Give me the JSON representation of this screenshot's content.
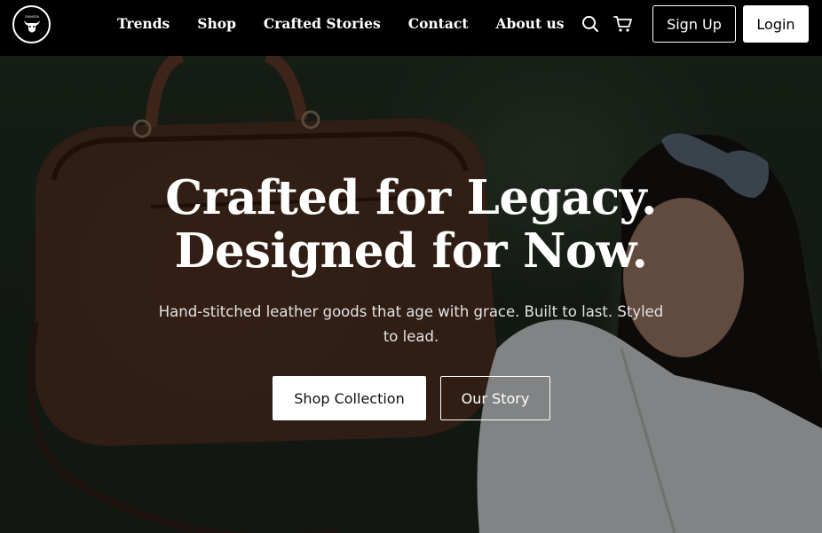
{
  "brand": {
    "logo_text": "ZAMAEDA"
  },
  "nav": {
    "items": [
      {
        "label": "Trends"
      },
      {
        "label": "Shop"
      },
      {
        "label": "Crafted Stories"
      },
      {
        "label": "Contact"
      },
      {
        "label": "About us"
      }
    ],
    "icons": [
      "search-icon",
      "cart-icon"
    ],
    "signup_label": "Sign Up",
    "login_label": "Login"
  },
  "hero": {
    "title_line1": "Crafted for Legacy.",
    "title_line2": "Designed for Now.",
    "subtitle": "Hand-stitched leather goods that age with grace. Built to last. Styled to lead.",
    "primary_cta": "Shop Collection",
    "secondary_cta": "Our Story"
  },
  "colors": {
    "nav_bg": "#000000",
    "text_primary": "#ffffff",
    "button_light_bg": "#ffffff",
    "button_light_text": "#000000"
  }
}
